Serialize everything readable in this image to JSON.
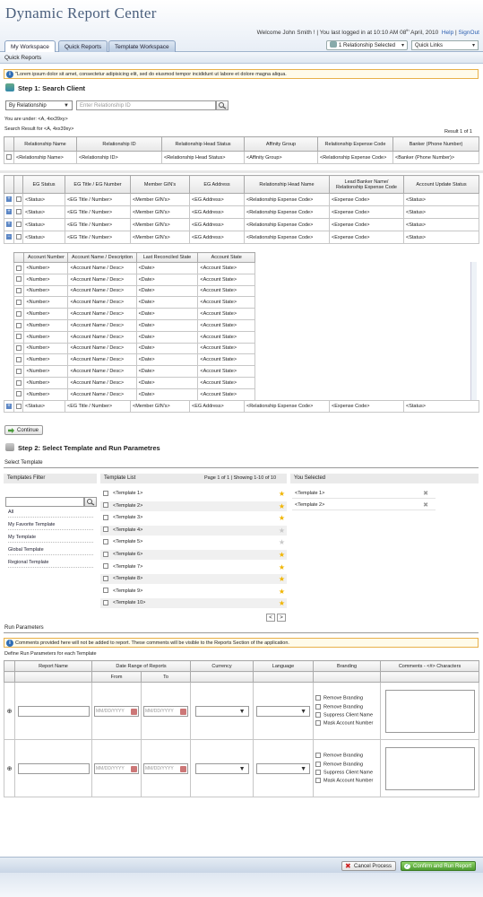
{
  "header": {
    "app_title": "Dynamic Report Center",
    "welcome": "Welcome John Smith ! | You last logged in at 10:10 AM 08",
    "welcome_sup": "th",
    "welcome_tail": " April, 2010",
    "help": "Help",
    "signout": "SignOut"
  },
  "tabs": [
    "My Workspace",
    "Quick Reports",
    "Template Workspace"
  ],
  "relationship_selected": "1 Relationship Selected",
  "quick_links": "Quick Links",
  "section_title": "Quick Reports",
  "info_text": "\"Lorem ipsum dolor sit amet, consectetur adipisicing elit, sed do eiusmod tempor incididunt ut labore et dolore magna aliqua.",
  "step1": {
    "title": "Step 1:  Search Client",
    "search_by": "By Relationship",
    "search_placeholder": "Enter Relationship ID",
    "under": "You are under: <A, 4xx39xy>",
    "result_for": "Search Result for <A, 4xx39xy>",
    "result_count": "Result 1 of 1"
  },
  "rel_table": {
    "headers": [
      "Relationship Name",
      "Relationship ID",
      "Relationship Head Status",
      "Affinity Group",
      "Relationship Expense Code",
      "Banker (Phone Number)"
    ],
    "row": [
      "<Relationship Name>",
      "<Relationship ID>",
      "<Relationship Head Status>",
      "<Affinity Group>",
      "<Relationship Expense Code>",
      "<Banker (Phone Number)>"
    ]
  },
  "eg_table": {
    "headers": [
      "EG Status",
      "EG Title / EG Number",
      "Member GIN's",
      "EG Address",
      "Relationship Head Name",
      "Lead Banker Name/ Relationship Expense Code",
      "Account Update Status"
    ],
    "row": [
      "<Status>",
      "<EG Title / Number>",
      "<Member GIN's>",
      "<EG Address>",
      "<Relationship Expense Code>",
      "<Expense Code>",
      "<Status>"
    ],
    "sub_headers": [
      "Account Number",
      "Account Name / Description",
      "Last Reconciled State",
      "Account State"
    ],
    "sub_row": [
      "<Number>",
      "<Account Name / Desc>",
      "<Date>",
      "<Account State>"
    ]
  },
  "continue_label": "Continue",
  "step2": {
    "title": "Step 2:  Select Template and Run Parametres",
    "select_template": "Select Template",
    "filter_title": "Templates Filter",
    "filters": [
      "All",
      "My Favorite Template",
      "My Template",
      "Global Template",
      "Regional Template"
    ],
    "list_title": "Template List",
    "page_info": "Page 1 of 1 | Showing 1-10 of 10",
    "templates": [
      "<Template 1>",
      "<Template 2>",
      "<Template 3>",
      "<Template 4>",
      "<Template 5>",
      "<Template 6>",
      "<Template 7>",
      "<Template 8>",
      "<Template 9>",
      "<Template 10>"
    ],
    "you_selected": "You Selected",
    "selected": [
      "<Template 1>",
      "<Template 2>"
    ],
    "prev": "<",
    "next": ">"
  },
  "run": {
    "title": "Run Parameters",
    "info": "Comments provided here will not be added to report. These comments will be visible to the Reports Section of the application.",
    "define": "Define Run Parameters for each Template",
    "headers": [
      "Report Name",
      "Date Range of Reports",
      "Currency",
      "Language",
      "Branding",
      "Comments - <#> Characters"
    ],
    "from": "From",
    "to": "To",
    "date_ph": "MM/DD/YYYY",
    "branding": [
      "Remove Branding",
      "Remove Branding",
      "Suppress Client Name",
      "Mask Account Number"
    ]
  },
  "actions": {
    "cancel": "Cancel Process",
    "confirm": "Confirm and Run Report"
  },
  "colors": {
    "accent": "#2a5db0",
    "header": "#4a5f7d",
    "star": "#f0b400",
    "confirm": "#5aa83c"
  }
}
